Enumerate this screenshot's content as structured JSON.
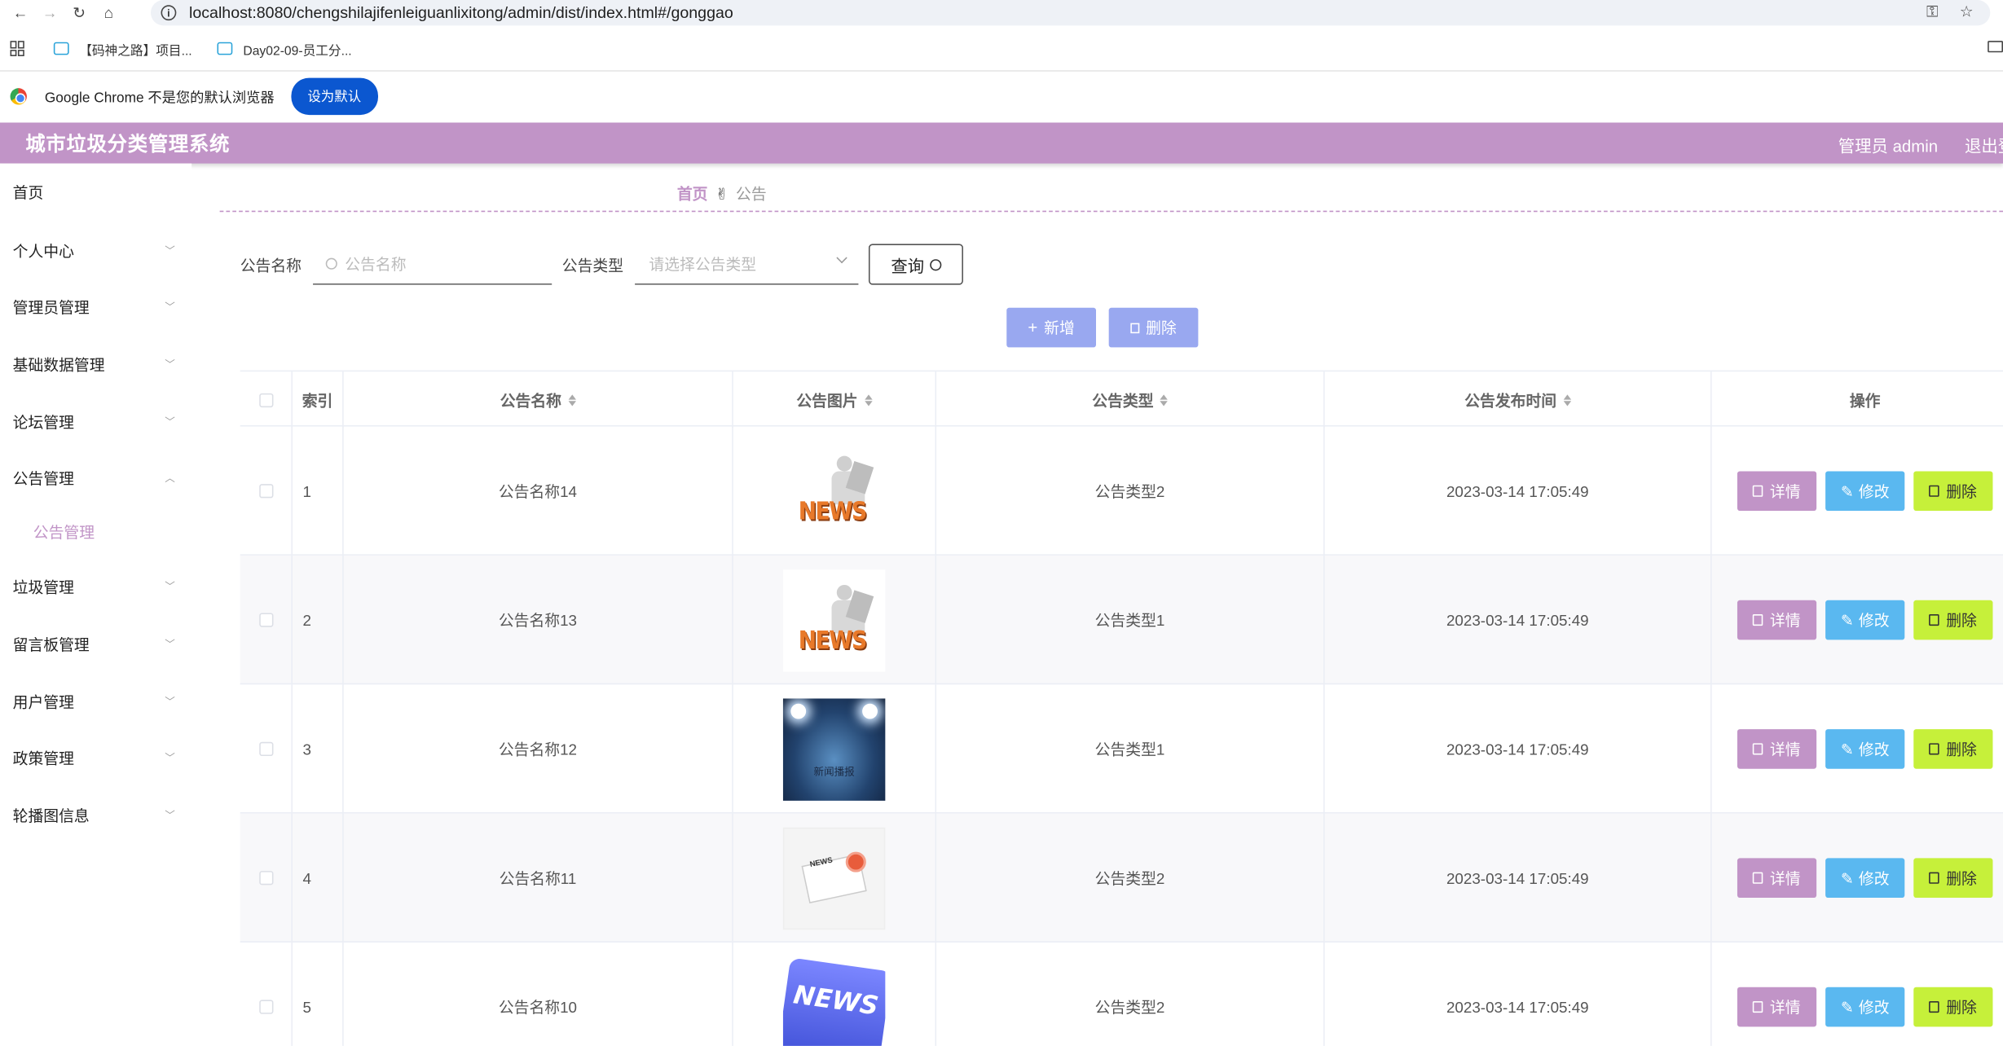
{
  "browser": {
    "url": "localhost:8080/chengshilajifenleiguanlixitong/admin/dist/index.html#/gonggao",
    "bookmarks": [
      "【码神之路】项目...",
      "Day02-09-员工分..."
    ],
    "infobar_text": "Google Chrome 不是您的默认浏览器",
    "infobar_button": "设为默认"
  },
  "header": {
    "title": "城市垃圾分类管理系统",
    "user": "管理员 admin",
    "logout": "退出登"
  },
  "sidebar": {
    "items": [
      {
        "label": "首页"
      },
      {
        "label": "个人中心"
      },
      {
        "label": "管理员管理"
      },
      {
        "label": "基础数据管理"
      },
      {
        "label": "论坛管理"
      },
      {
        "label": "公告管理"
      },
      {
        "label": "垃圾管理"
      },
      {
        "label": "留言板管理"
      },
      {
        "label": "用户管理"
      },
      {
        "label": "政策管理"
      },
      {
        "label": "轮播图信息"
      }
    ],
    "active_sub": "公告管理"
  },
  "breadcrumb": {
    "home": "首页",
    "current": "公告"
  },
  "search": {
    "name_label": "公告名称",
    "name_placeholder": "公告名称",
    "type_label": "公告类型",
    "type_placeholder": "请选择公告类型",
    "query_label": "查询"
  },
  "actions": {
    "add": "新增",
    "delete": "删除"
  },
  "table": {
    "headers": {
      "index": "索引",
      "name": "公告名称",
      "image": "公告图片",
      "type": "公告类型",
      "time": "公告发布时间",
      "ops": "操作"
    },
    "op_labels": {
      "detail": "详情",
      "edit": "修改",
      "delete": "删除"
    },
    "rows": [
      {
        "index": "1",
        "name": "公告名称14",
        "image": "news-figure",
        "type": "公告类型2",
        "time": "2023-03-14 17:05:49"
      },
      {
        "index": "2",
        "name": "公告名称13",
        "image": "news-figure",
        "type": "公告类型1",
        "time": "2023-03-14 17:05:49"
      },
      {
        "index": "3",
        "name": "公告名称12",
        "image": "stage-spotlight",
        "image_text": "新闻播报",
        "type": "公告类型1",
        "time": "2023-03-14 17:05:49"
      },
      {
        "index": "4",
        "name": "公告名称11",
        "image": "newspaper",
        "image_text": "NEWS",
        "type": "公告类型2",
        "time": "2023-03-14 17:05:49"
      },
      {
        "index": "5",
        "name": "公告名称10",
        "image": "news-key",
        "image_text": "NEWS",
        "type": "公告类型2",
        "time": "2023-03-14 17:05:49"
      }
    ]
  },
  "colors": {
    "primary": "#c194c7",
    "add_button": "#99a8f0",
    "edit_button": "#5ab8f0",
    "delete_button": "#c6f03a"
  }
}
